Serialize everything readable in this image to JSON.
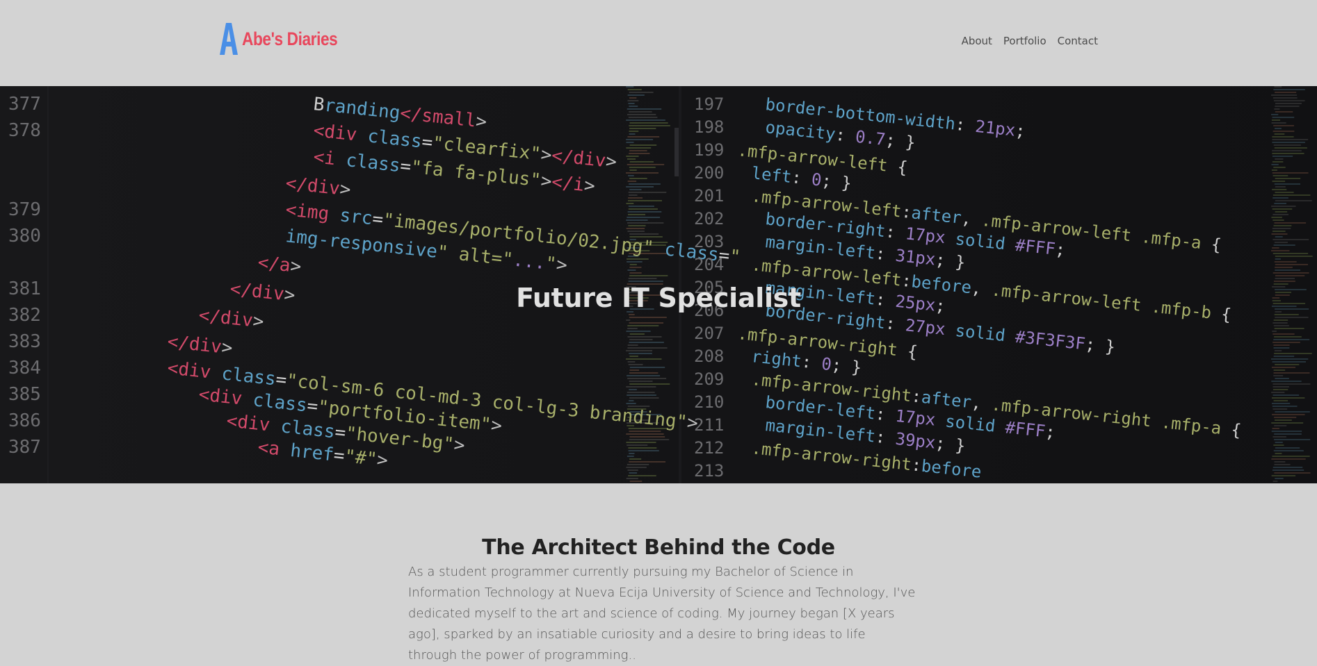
{
  "navbar": {
    "brand_letter": "A",
    "brand_text": "Abe's Diaries",
    "links": [
      "About",
      "Portfolio",
      "Contact"
    ]
  },
  "hero": {
    "title": "Future IT Specialist",
    "code_left": {
      "lines": [
        {
          "num": "377",
          "code": "Branding</small>"
        },
        {
          "num": "378",
          "code": "<div class=\"clearfix\"></div>"
        },
        {
          "num": "",
          "code": "<i class=\"fa fa-plus\"></i>"
        },
        {
          "num": "",
          "code": "</div>"
        },
        {
          "num": "379",
          "code": "<img src=\"images/portfolio/02.jpg\" class=\""
        },
        {
          "num": "380",
          "code": "img-responsive\" alt=\"...\">"
        },
        {
          "num": "",
          "code": "</a>"
        },
        {
          "num": "381",
          "code": "</div>"
        },
        {
          "num": "382",
          "code": "</div>"
        },
        {
          "num": "383",
          "code": "</div>"
        },
        {
          "num": "384",
          "code": "<div class=\"col-sm-6 col-md-3 col-lg-3 branding\">"
        },
        {
          "num": "385",
          "code": "<div class=\"portfolio-item\">"
        },
        {
          "num": "386",
          "code": "<div class=\"hover-bg\">"
        },
        {
          "num": "387",
          "code": "<a href=\"#\">"
        }
      ]
    },
    "code_right": {
      "lines": [
        {
          "num": "197",
          "code": "border-bottom-width: 21px;"
        },
        {
          "num": "198",
          "code": "opacity: 0.7; }"
        },
        {
          "num": "199",
          "code": ".mfp-arrow-left {"
        },
        {
          "num": "200",
          "code": "left: 0; }"
        },
        {
          "num": "201",
          "code": ".mfp-arrow-left:after, .mfp-arrow-left .mfp-a {"
        },
        {
          "num": "202",
          "code": "border-right: 17px solid #FFF;"
        },
        {
          "num": "203",
          "code": "margin-left: 31px; }"
        },
        {
          "num": "204",
          "code": ".mfp-arrow-left:before, .mfp-arrow-left .mfp-b {"
        },
        {
          "num": "205",
          "code": "margin-left: 25px;"
        },
        {
          "num": "206",
          "code": "border-right: 27px solid #3F3F3F; }"
        },
        {
          "num": "207",
          "code": ".mfp-arrow-right {"
        },
        {
          "num": "208",
          "code": "right: 0; }"
        },
        {
          "num": "209",
          "code": ".mfp-arrow-right:after, .mfp-arrow-right .mfp-a {"
        },
        {
          "num": "210",
          "code": "border-left: 17px solid #FFF;"
        },
        {
          "num": "211",
          "code": "margin-left: 39px; }"
        },
        {
          "num": "212",
          "code": ".mfp-arrow-right:before"
        },
        {
          "num": "213",
          "code": ""
        }
      ]
    }
  },
  "about": {
    "title": "The Architect Behind the Code",
    "paragraph": "As a student programmer currently pursuing my Bachelor of Science in Information Technology at Nueva Ecija University of Science and Technology, I've dedicated myself to the art and science of coding. My journey began [X years ago], sparked by an insatiable curiosity and a desire to bring ideas to life through the power of programming.."
  },
  "colors": {
    "brand_red": "#e8475c",
    "brand_blue": "#4a8fe6",
    "page_bg": "#d3d3d3",
    "hero_bg": "#121214",
    "code_tag": "#d24a6a",
    "code_attr": "#a8b06a",
    "code_prop": "#5ea3c9",
    "code_number": "#9c7fc7"
  }
}
